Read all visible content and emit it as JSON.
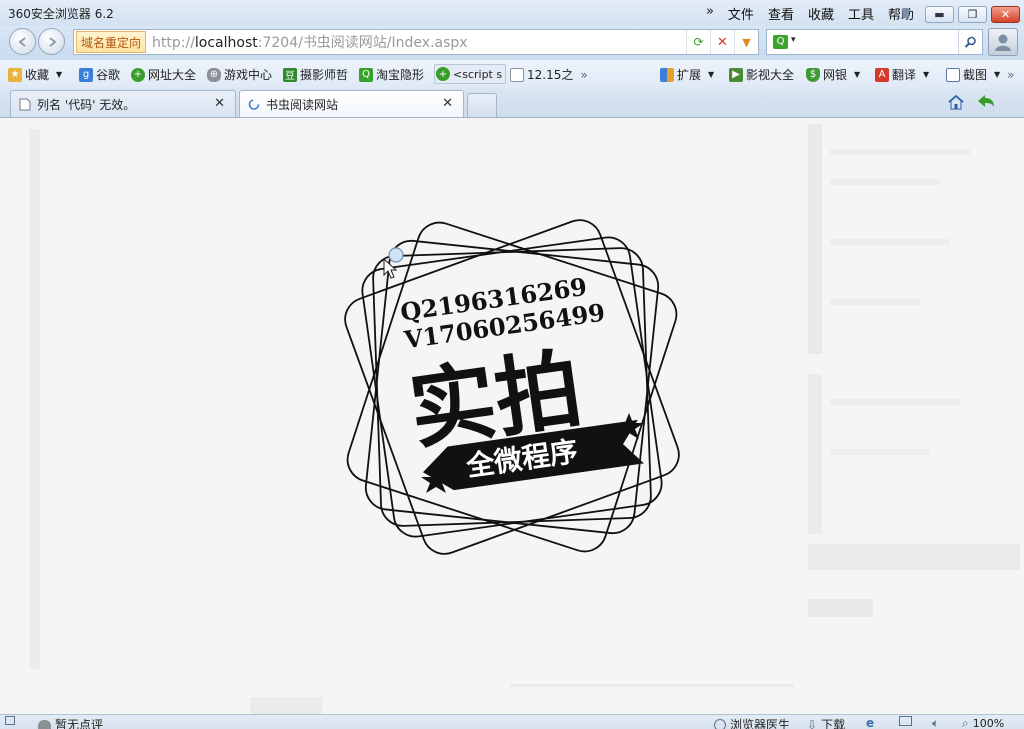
{
  "window": {
    "title": "360安全浏览器 6.2",
    "menu": [
      "文件",
      "查看",
      "收藏",
      "工具",
      "帮助"
    ],
    "menu_more": "»"
  },
  "nav": {
    "redirect_label": "域名重定向",
    "url_prefix": "http://",
    "url_host": "localhost",
    "url_rest": ":7204/书虫阅读网站/Index.aspx",
    "search_value": ""
  },
  "favorites": {
    "items": [
      "收藏",
      "谷歌",
      "网址大全",
      "游戏中心",
      "摄影师哲",
      "淘宝隐形",
      "<script s",
      "12.15之"
    ],
    "more": "»",
    "right_items": [
      "扩展",
      "影视大全",
      "网银",
      "翻译",
      "截图"
    ],
    "right_more": "»"
  },
  "tabs": [
    {
      "label": "列名 '代码' 无效。",
      "active": false
    },
    {
      "label": "书虫阅读网站",
      "active": true
    }
  ],
  "logo": {
    "line1": "Q2196316269",
    "line2": "V17060256499",
    "big_text": "实拍",
    "banner_text": "全微程序"
  },
  "status": {
    "left_text": "暂无点评",
    "doctor": "浏览器医生",
    "download": "下载",
    "zoom": "100%"
  },
  "colors": {
    "accent": "#c9dbee",
    "redirect_text": "#b0580e",
    "close_btn": "#d4432b"
  }
}
